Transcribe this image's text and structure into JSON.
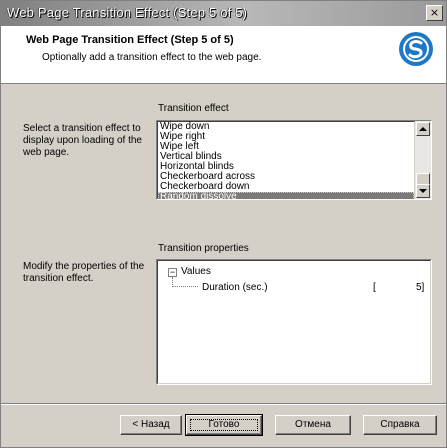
{
  "window": {
    "title": "Web Page Transition Effect (Step 5 of 5)",
    "close_glyph": "×"
  },
  "header": {
    "title": "Web Page Transition Effect (Step 5 of 5)",
    "subtitle": "Optionally add a transition effect to the web page."
  },
  "transition": {
    "section_label": "Transition effect",
    "description": "Select a transition effect to display upon loading of the web page.",
    "items": [
      "Wipe down",
      "Wipe right",
      "Wipe left",
      "Vertical blinds",
      "Horizontal blinds",
      "Checkerboard across",
      "Checkerboard down",
      "Random dissolve"
    ],
    "selected": "Random dissolve"
  },
  "properties": {
    "section_label": "Transition properties",
    "description": "Modify the properties of the transition effect.",
    "tree_toggle": "−",
    "group": "Values",
    "property_name": "Duration (sec.)",
    "value_prefix": "[",
    "value": "5]"
  },
  "buttons": {
    "back": "< Назад",
    "finish": "Готово",
    "cancel": "Отмена",
    "help": "Справка"
  },
  "colors": {
    "selection": "#7b7b7b",
    "logo_accent": "#1e78c8"
  },
  "icons": [
    "close-icon",
    "app-logo-icon",
    "scroll-up-icon",
    "scroll-down-icon",
    "tree-collapse-icon"
  ]
}
